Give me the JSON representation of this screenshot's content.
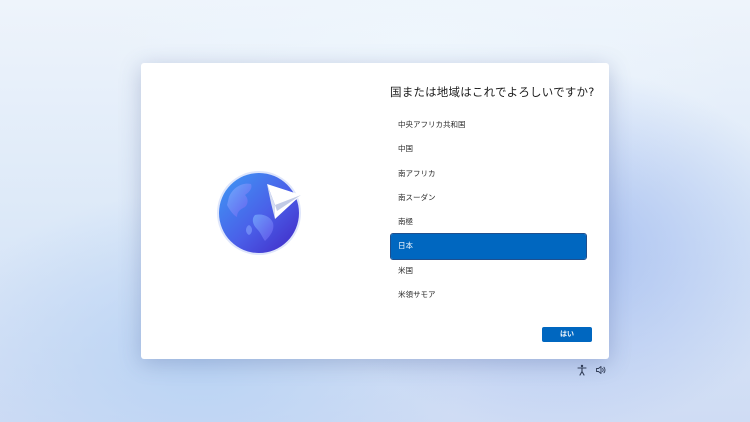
{
  "dialog": {
    "title": "国または地域はこれでよろしいですか?",
    "illustration_icon": "globe-with-paper-plane",
    "regions": [
      {
        "label": "中央アフリカ共和国",
        "selected": false
      },
      {
        "label": "中国",
        "selected": false
      },
      {
        "label": "南アフリカ",
        "selected": false
      },
      {
        "label": "南スーダン",
        "selected": false
      },
      {
        "label": "南極",
        "selected": false
      },
      {
        "label": "日本",
        "selected": true
      },
      {
        "label": "米国",
        "selected": false
      },
      {
        "label": "米領サモア",
        "selected": false
      }
    ],
    "confirm_label": "はい"
  },
  "tray": {
    "icons": [
      "accessibility-icon",
      "volume-icon"
    ]
  },
  "colors": {
    "accent": "#0067c0",
    "globe_light": "#4c7cf2",
    "globe_dark": "#3a2fd0"
  }
}
